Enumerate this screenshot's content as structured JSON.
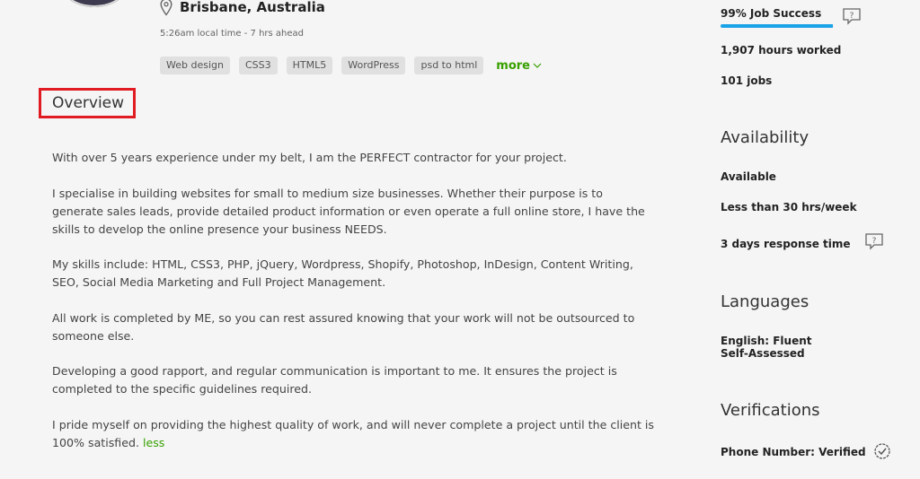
{
  "profile": {
    "location": "Brisbane, Australia",
    "local_time": "5:26am local time - 7 hrs ahead",
    "skills": [
      "Web design",
      "CSS3",
      "HTML5",
      "WordPress",
      "psd to html"
    ],
    "more_label": "more"
  },
  "overview": {
    "title": "Overview",
    "paragraphs": [
      "With over 5 years experience under my belt, I am the PERFECT contractor for your project.",
      "I specialise in building websites for small to medium size businesses. Whether their purpose is to generate sales leads, provide detailed product information or even operate a full online store, I have the skills to develop the online presence your business NEEDS.",
      "My skills include: HTML, CSS3, PHP, jQuery, Wordpress, Shopify, Photoshop, InDesign, Content Writing, SEO, Social Media Marketing and Full Project Management.",
      "All work is completed by ME, so you can rest assured knowing that your work will not be outsourced to someone else.",
      "Developing a good rapport, and regular communication is important to me. It ensures the project is completed to the specific guidelines required.",
      "I pride myself on providing the highest quality of work, and will never complete a project until the client is 100% satisfied."
    ],
    "less_label": "less"
  },
  "sidebar": {
    "job_success": "99% Job Success",
    "job_success_fraction": 0.99,
    "hours_worked": "1,907 hours worked",
    "jobs": "101 jobs",
    "availability_title": "Availability",
    "availability_status": "Available",
    "availability_hours": "Less than 30 hrs/week",
    "response_time": "3 days response time",
    "languages_title": "Languages",
    "language_entry": "English: Fluent",
    "language_level": "Self-Assessed",
    "verifications_title": "Verifications",
    "phone_verified": "Phone Number: Verified"
  },
  "colors": {
    "accent_green": "#37a000",
    "job_success_blue": "#1aa3e8",
    "highlight_red": "#e11b22"
  }
}
